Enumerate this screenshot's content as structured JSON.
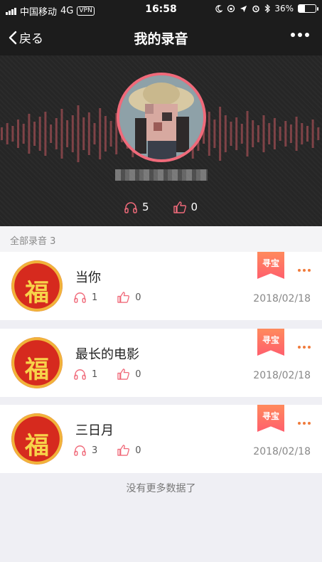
{
  "status_bar": {
    "carrier": "中国移动",
    "network": "4G",
    "vpn": "VPN",
    "time": "16:58",
    "battery_percent": "36%",
    "battery_level": 0.36
  },
  "nav": {
    "back_label": "戻る",
    "title": "我的录音"
  },
  "profile": {
    "listens": "5",
    "likes": "0"
  },
  "section": {
    "label": "全部录音",
    "count": "3"
  },
  "records": [
    {
      "title": "当你",
      "listens": "1",
      "likes": "0",
      "date": "2018/02/18",
      "badge": "寻宝",
      "thumb_char": "福"
    },
    {
      "title": "最长的电影",
      "listens": "1",
      "likes": "0",
      "date": "2018/02/18",
      "badge": "寻宝",
      "thumb_char": "福"
    },
    {
      "title": "三日月",
      "listens": "3",
      "likes": "0",
      "date": "2018/02/18",
      "badge": "寻宝",
      "thumb_char": "福"
    }
  ],
  "footer": {
    "no_more_text": "没有更多数据了"
  },
  "colors": {
    "accent": "#f06a7a",
    "badge_start": "#ff8a5c",
    "badge_end": "#ff5f6d",
    "more_dots": "#f07b3c",
    "bar_dark": "#1c1c1c"
  },
  "icons": {
    "listen": "headphones-icon",
    "like": "thumbs-up-icon",
    "back": "chevron-left-icon",
    "more": "more-dots-icon"
  }
}
